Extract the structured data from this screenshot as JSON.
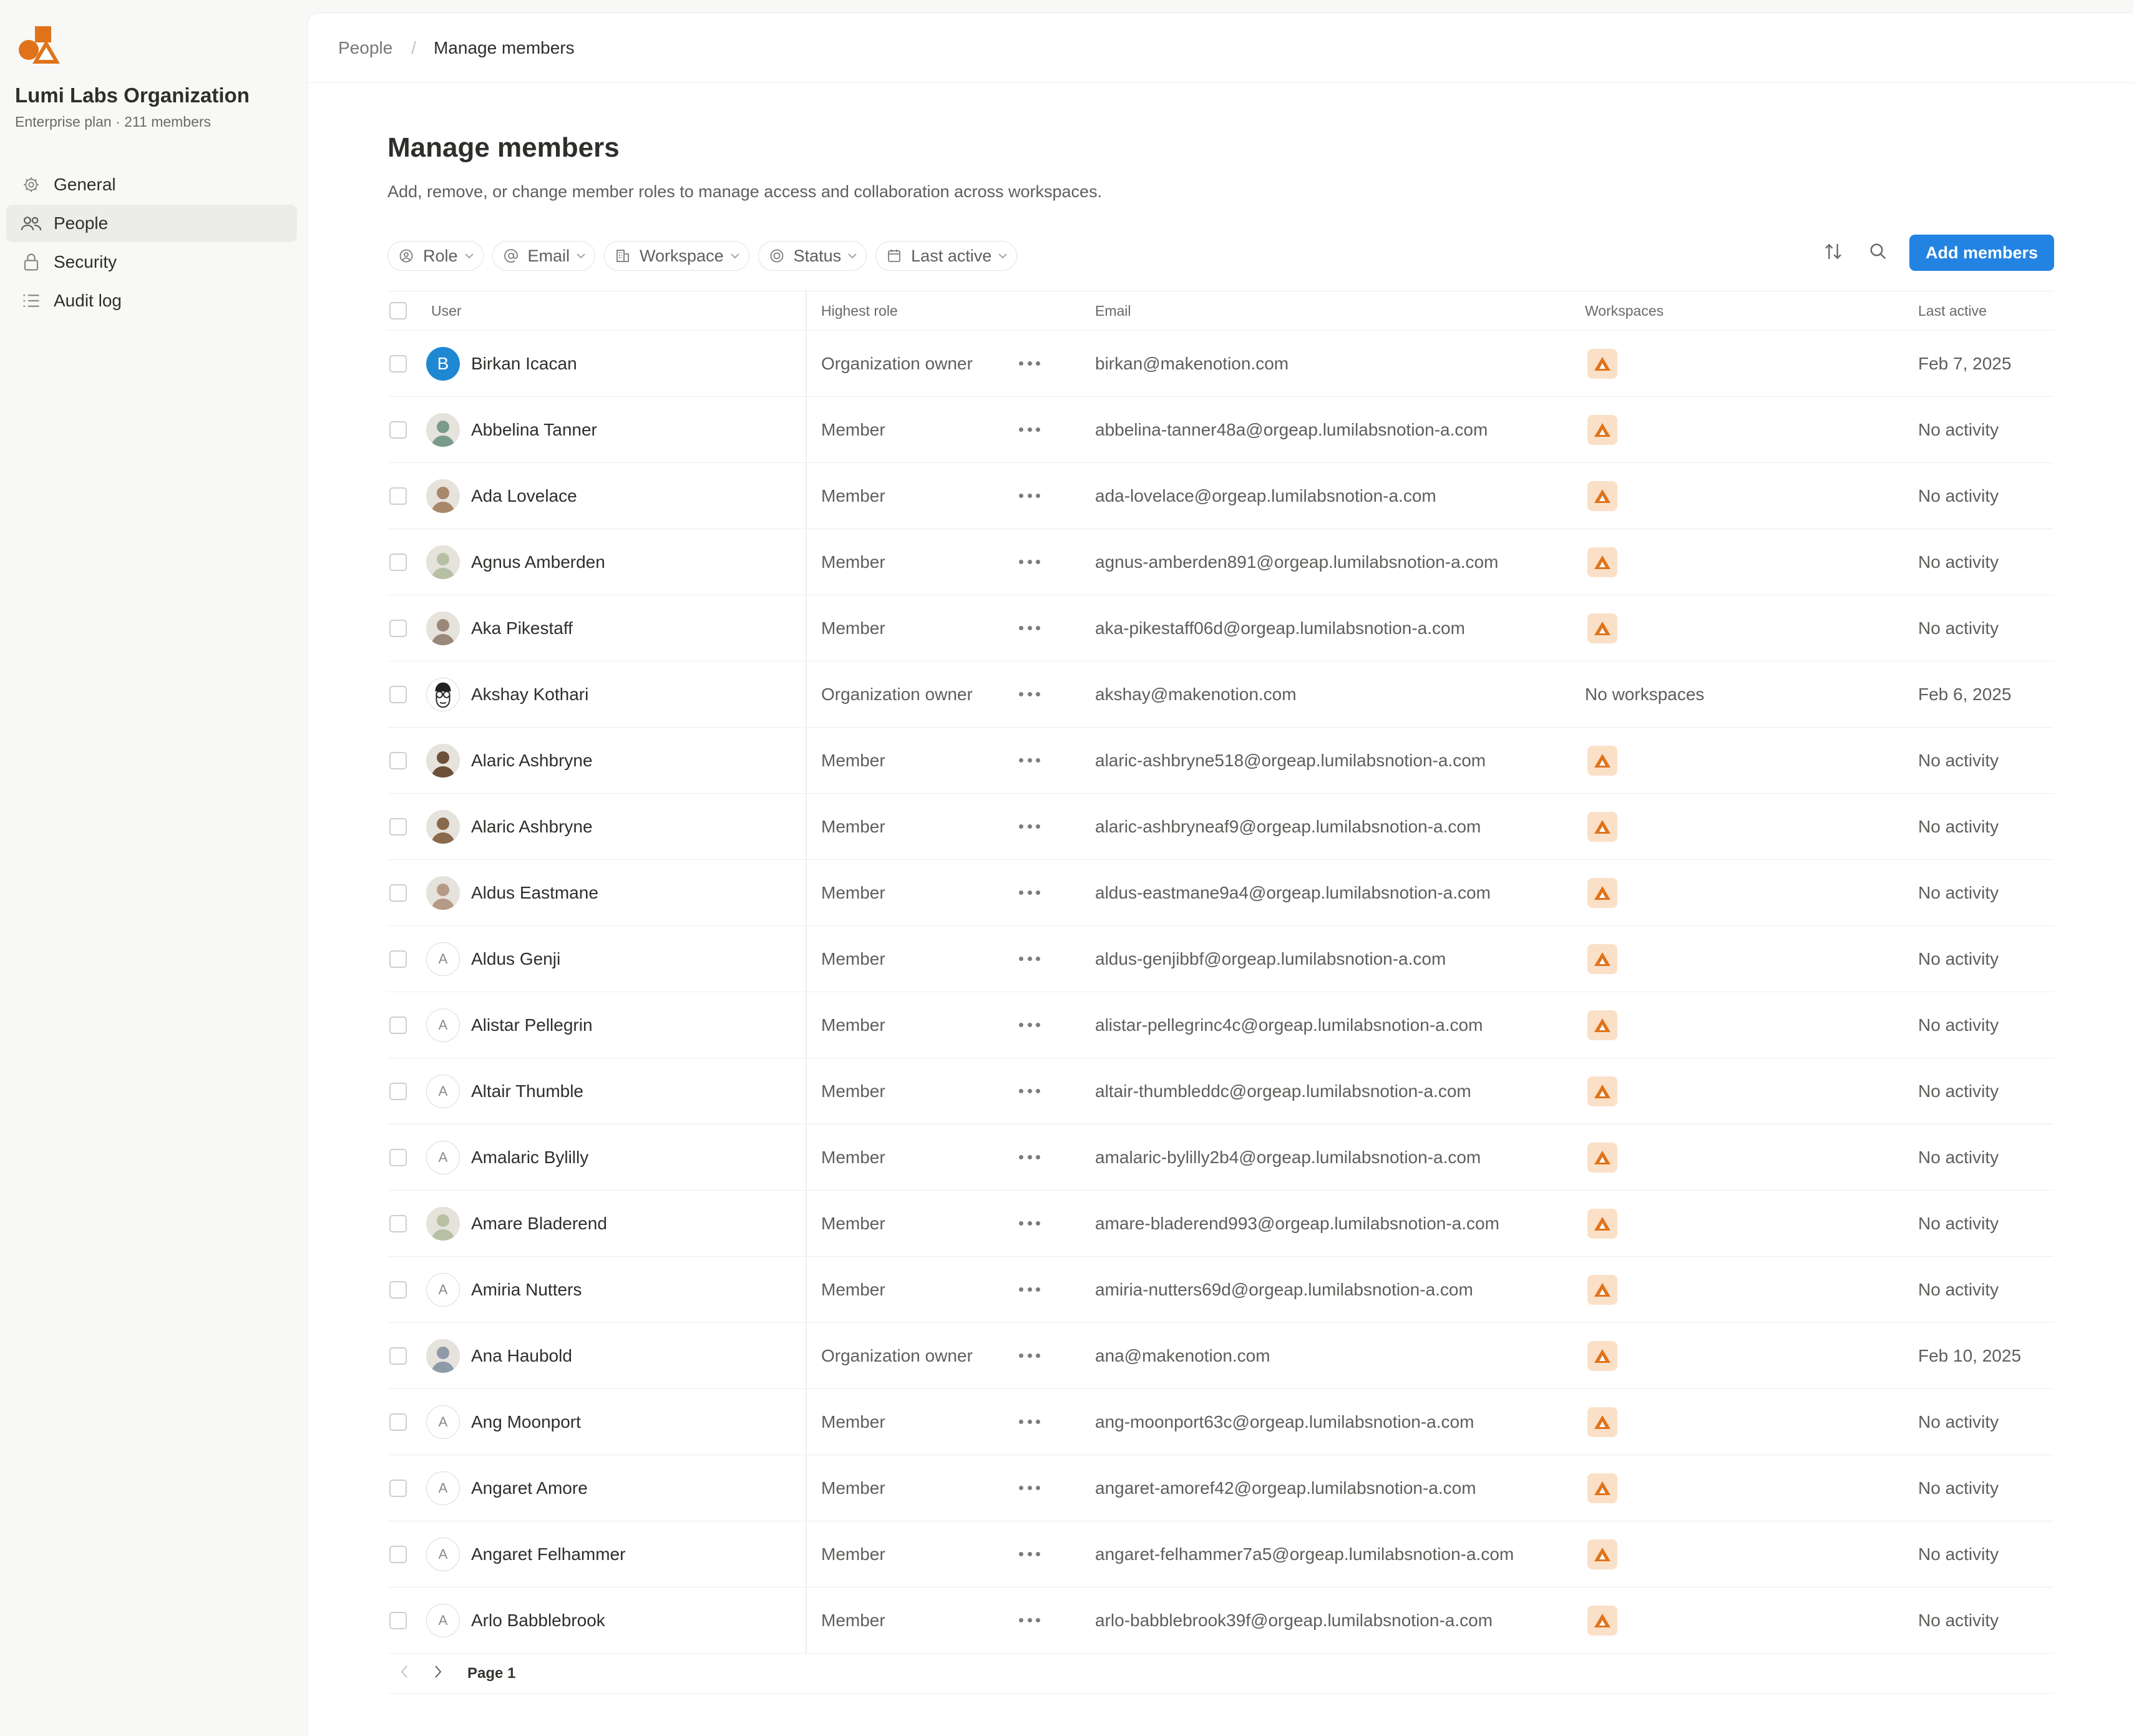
{
  "sidebar": {
    "org_name": "Lumi Labs Organization",
    "org_sub": "Enterprise plan · 211 members",
    "items": [
      {
        "label": "General",
        "icon": "gear-icon"
      },
      {
        "label": "People",
        "icon": "people-icon",
        "active": true
      },
      {
        "label": "Security",
        "icon": "lock-icon"
      },
      {
        "label": "Audit log",
        "icon": "list-icon"
      }
    ]
  },
  "breadcrumb": {
    "parent": "People",
    "separator": "/",
    "current": "Manage members"
  },
  "page": {
    "title": "Manage members",
    "description": "Add, remove, or change member roles to manage access and collaboration across workspaces."
  },
  "filters": [
    {
      "label": "Role",
      "icon": "person-circle-icon"
    },
    {
      "label": "Email",
      "icon": "at-icon"
    },
    {
      "label": "Workspace",
      "icon": "building-icon"
    },
    {
      "label": "Status",
      "icon": "status-circle-icon"
    },
    {
      "label": "Last active",
      "icon": "calendar-icon"
    }
  ],
  "toolbar": {
    "add_label": "Add members"
  },
  "table": {
    "headers": {
      "user": "User",
      "role": "Highest role",
      "email": "Email",
      "workspaces": "Workspaces",
      "last_active": "Last active"
    },
    "rows": [
      {
        "name": "Birkan Icacan",
        "avatar": "B",
        "avatar_type": "blue",
        "role": "Organization owner",
        "email": "birkan@makenotion.com",
        "workspaces": "",
        "last_active": "Feb 7, 2025"
      },
      {
        "name": "Abbelina Tanner",
        "avatar": "",
        "avatar_type": "photo",
        "role": "Member",
        "email": "abbelina-tanner48a@orgeap.lumilabsnotion-a.com",
        "workspaces": "",
        "last_active": "No activity"
      },
      {
        "name": "Ada Lovelace",
        "avatar": "",
        "avatar_type": "photo",
        "role": "Member",
        "email": "ada-lovelace@orgeap.lumilabsnotion-a.com",
        "workspaces": "",
        "last_active": "No activity"
      },
      {
        "name": "Agnus Amberden",
        "avatar": "",
        "avatar_type": "photo",
        "role": "Member",
        "email": "agnus-amberden891@orgeap.lumilabsnotion-a.com",
        "workspaces": "",
        "last_active": "No activity"
      },
      {
        "name": "Aka Pikestaff",
        "avatar": "",
        "avatar_type": "photo",
        "role": "Member",
        "email": "aka-pikestaff06d@orgeap.lumilabsnotion-a.com",
        "workspaces": "",
        "last_active": "No activity"
      },
      {
        "name": "Akshay Kothari",
        "avatar": "",
        "avatar_type": "sketch",
        "role": "Organization owner",
        "email": "akshay@makenotion.com",
        "workspaces": "No workspaces",
        "last_active": "Feb 6, 2025"
      },
      {
        "name": "Alaric Ashbryne",
        "avatar": "",
        "avatar_type": "photo",
        "role": "Member",
        "email": "alaric-ashbryne518@orgeap.lumilabsnotion-a.com",
        "workspaces": "",
        "last_active": "No activity"
      },
      {
        "name": "Alaric Ashbryne",
        "avatar": "",
        "avatar_type": "photo",
        "role": "Member",
        "email": "alaric-ashbryneaf9@orgeap.lumilabsnotion-a.com",
        "workspaces": "",
        "last_active": "No activity"
      },
      {
        "name": "Aldus Eastmane",
        "avatar": "",
        "avatar_type": "photo",
        "role": "Member",
        "email": "aldus-eastmane9a4@orgeap.lumilabsnotion-a.com",
        "workspaces": "",
        "last_active": "No activity"
      },
      {
        "name": "Aldus Genji",
        "avatar": "A",
        "avatar_type": "letter",
        "role": "Member",
        "email": "aldus-genjibbf@orgeap.lumilabsnotion-a.com",
        "workspaces": "",
        "last_active": "No activity"
      },
      {
        "name": "Alistar Pellegrin",
        "avatar": "A",
        "avatar_type": "letter",
        "role": "Member",
        "email": "alistar-pellegrinc4c@orgeap.lumilabsnotion-a.com",
        "workspaces": "",
        "last_active": "No activity"
      },
      {
        "name": "Altair Thumble",
        "avatar": "A",
        "avatar_type": "letter",
        "role": "Member",
        "email": "altair-thumbleddc@orgeap.lumilabsnotion-a.com",
        "workspaces": "",
        "last_active": "No activity"
      },
      {
        "name": "Amalaric Bylilly",
        "avatar": "A",
        "avatar_type": "letter",
        "role": "Member",
        "email": "amalaric-bylilly2b4@orgeap.lumilabsnotion-a.com",
        "workspaces": "",
        "last_active": "No activity"
      },
      {
        "name": "Amare Bladerend",
        "avatar": "",
        "avatar_type": "photo",
        "role": "Member",
        "email": "amare-bladerend993@orgeap.lumilabsnotion-a.com",
        "workspaces": "",
        "last_active": "No activity"
      },
      {
        "name": "Amiria Nutters",
        "avatar": "A",
        "avatar_type": "letter",
        "role": "Member",
        "email": "amiria-nutters69d@orgeap.lumilabsnotion-a.com",
        "workspaces": "",
        "last_active": "No activity"
      },
      {
        "name": "Ana Haubold",
        "avatar": "",
        "avatar_type": "photo",
        "role": "Organization owner",
        "email": "ana@makenotion.com",
        "workspaces": "",
        "last_active": "Feb 10, 2025"
      },
      {
        "name": "Ang Moonport",
        "avatar": "A",
        "avatar_type": "letter",
        "role": "Member",
        "email": "ang-moonport63c@orgeap.lumilabsnotion-a.com",
        "workspaces": "",
        "last_active": "No activity"
      },
      {
        "name": "Angaret Amore",
        "avatar": "A",
        "avatar_type": "letter",
        "role": "Member",
        "email": "angaret-amoref42@orgeap.lumilabsnotion-a.com",
        "workspaces": "",
        "last_active": "No activity"
      },
      {
        "name": "Angaret Felhammer",
        "avatar": "A",
        "avatar_type": "letter",
        "role": "Member",
        "email": "angaret-felhammer7a5@orgeap.lumilabsnotion-a.com",
        "workspaces": "",
        "last_active": "No activity"
      },
      {
        "name": "Arlo Babblebrook",
        "avatar": "A",
        "avatar_type": "letter",
        "role": "Member",
        "email": "arlo-babblebrook39f@orgeap.lumilabsnotion-a.com",
        "workspaces": "",
        "last_active": "No activity"
      }
    ]
  },
  "pagination": {
    "label": "Page 1"
  },
  "colors": {
    "accent": "#2383e2",
    "brand": "#e0731a",
    "workspace_bg": "#fbe0c8"
  }
}
